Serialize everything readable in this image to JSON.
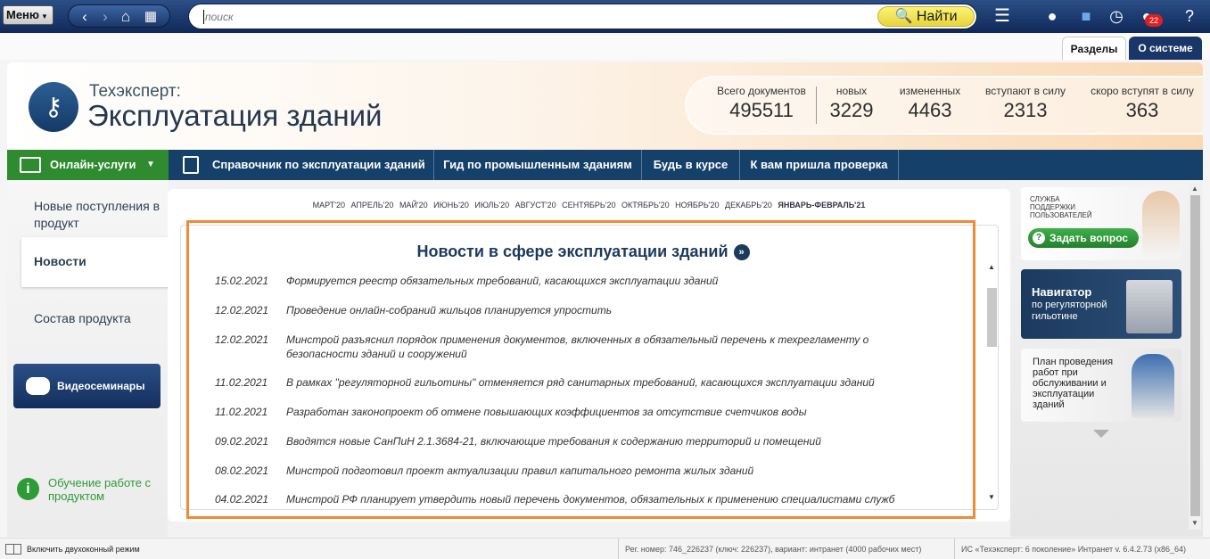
{
  "toolbar": {
    "menu_label": "Меню",
    "search_placeholder": "поиск",
    "find_label": "Найти",
    "notification_count": "22"
  },
  "section_tabs": [
    "Разделы",
    "О системе"
  ],
  "product": {
    "brand": "Техэксперт:",
    "title": "Эксплуатация зданий"
  },
  "stats": [
    {
      "label": "Всего документов",
      "value": "495511"
    },
    {
      "label": "новых",
      "value": "3229"
    },
    {
      "label": "измененных",
      "value": "4463"
    },
    {
      "label": "вступают в силу",
      "value": "2313"
    },
    {
      "label": "скоро вступят в силу",
      "value": "363"
    }
  ],
  "nav": {
    "online": "Онлайн-услуги",
    "items": [
      "Справочник по эксплуатации зданий",
      "Гид по промышленным зданиям",
      "Будь в курсе",
      "К вам пришла проверка"
    ]
  },
  "left_nav": {
    "items": [
      "Новые поступления в продукт",
      "Новости",
      "Состав продукта"
    ],
    "video_label": "Видеосеминары",
    "help_label": "Обучение работе с продуктом"
  },
  "months": [
    "МАРТ'20",
    "АПРЕЛЬ'20",
    "МАЙ'20",
    "ИЮНЬ'20",
    "ИЮЛЬ'20",
    "АВГУСТ'20",
    "СЕНТЯБРЬ'20",
    "ОКТЯБРЬ'20",
    "НОЯБРЬ'20",
    "ДЕКАБРЬ'20",
    "ЯНВАРЬ-ФЕВРАЛЬ'21"
  ],
  "news": {
    "title": "Новости в сфере эксплуатации зданий",
    "items": [
      {
        "date": "15.02.2021",
        "text": "Формируется реестр обязательных требований, касающихся эксплуатации зданий"
      },
      {
        "date": "12.02.2021",
        "text": "Проведение онлайн-собраний жильцов планируется упростить"
      },
      {
        "date": "12.02.2021",
        "text": "Минстрой разъяснил порядок применения документов, включенных в обязательный перечень к техрегламенту о безопасности зданий и сооружений"
      },
      {
        "date": "11.02.2021",
        "text": "В рамках \"регуляторной гильотины\" отменяется ряд санитарных требований, касающихся эксплуатации зданий"
      },
      {
        "date": "11.02.2021",
        "text": "Разработан законопроект об отмене повышающих коэффициентов за отсутствие счетчиков воды"
      },
      {
        "date": "09.02.2021",
        "text": "Вводятся новые СанПиН 2.1.3684-21, включающие требования к содержанию территорий и помещений"
      },
      {
        "date": "08.02.2021",
        "text": "Минстрой подготовил проект актуализации правил капитального ремонта жилых зданий"
      },
      {
        "date": "04.02.2021",
        "text": "Минстрой РФ планирует утвердить новый перечень документов, обязательных к применению специалистами служб"
      }
    ]
  },
  "banners": {
    "support_title": "СЛУЖБА ПОДДЕРЖКИ ПОЛЬЗОВАТЕЛЕЙ",
    "support_button": "Задать вопрос",
    "navigator_title": "Навигатор",
    "navigator_sub": "по регуляторной гильотине",
    "plan_title": "План проведения работ при обслуживании и эксплуатации зданий"
  },
  "statusbar": {
    "dual_mode": "Включить двухоконный режим",
    "reg_info": "Рег. номер: 746_226237 (ключ: 226237), вариант: интранет (4000 рабочих мест)",
    "sys_info": "ИС «Техэксперт: 6 поколение» Интранет v. 6.4.2.73 (x86_64)"
  },
  "colors": {
    "accent_green": "#2e8b2f",
    "nav_blue": "#14406a",
    "highlight_orange": "#f08a35",
    "find_yellow": "#f4e45a"
  }
}
